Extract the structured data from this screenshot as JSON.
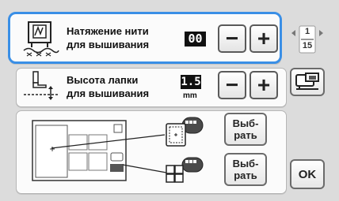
{
  "thread_tension": {
    "label_line1": "Натяжение нити",
    "label_line2": "для вышивания",
    "value": "00"
  },
  "foot_height": {
    "label_line1": "Высота лапки",
    "label_line2": "для вышивания",
    "value": "1.5",
    "unit": "mm"
  },
  "controls": {
    "minus": "−",
    "plus": "+"
  },
  "frame_select": {
    "button1_line1": "Выб-",
    "button1_line2": "рать",
    "button2_line1": "Выб-",
    "button2_line2": "рать"
  },
  "page_indicator": {
    "current": "1",
    "total": "15"
  },
  "ok_label": "OK"
}
